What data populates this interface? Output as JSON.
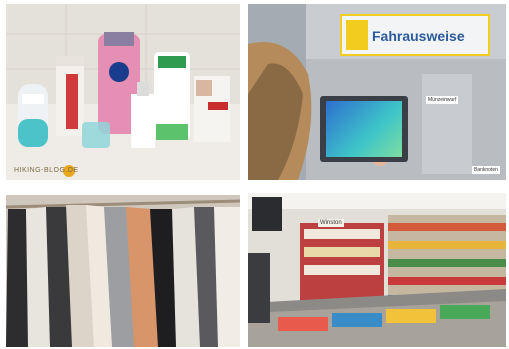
{
  "tiles": {
    "toiletries": {
      "watermark": "HIKING-BLOG.DE",
      "brands": [
        "Rexona",
        "NIVEA",
        "Scholl",
        "Balea"
      ]
    },
    "ticket_machine": {
      "sign": "Fahrausweise",
      "label_left": "Münzeinwurf",
      "label_right": "Banknoten"
    },
    "clothing_rack": {},
    "shop_shelves": {
      "sign": "Winston"
    }
  }
}
